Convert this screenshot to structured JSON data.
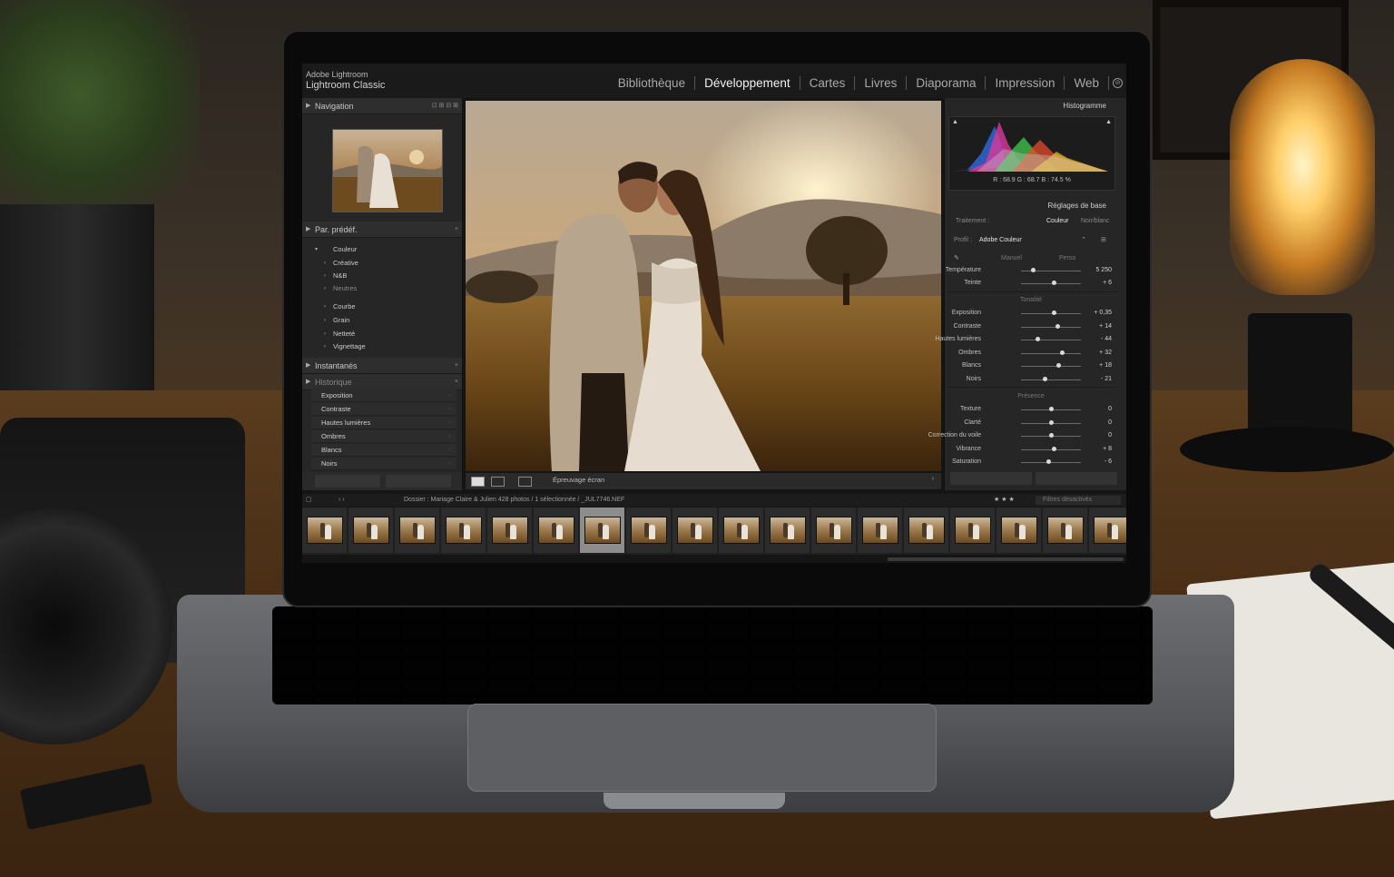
{
  "app": {
    "brand_top": "Adobe Lightroom",
    "brand_name": "Lightroom Classic"
  },
  "modules": [
    {
      "label": "Bibliothèque",
      "active": false
    },
    {
      "label": "Développement",
      "active": true
    },
    {
      "label": "Cartes",
      "active": false
    },
    {
      "label": "Livres",
      "active": false
    },
    {
      "label": "Diaporama",
      "active": false
    },
    {
      "label": "Impression",
      "active": false
    },
    {
      "label": "Web",
      "active": false
    }
  ],
  "left_panel": {
    "navigation_title": "Navigation",
    "presets_title": "Par. prédéf.",
    "presets": [
      "Couleur",
      "Créative",
      "N&B",
      "Neutres",
      "Courbe",
      "Grain",
      "Netteté",
      "Vignettage"
    ],
    "snapshots_title": "Instantanés",
    "history_title": "Historique",
    "history": [
      "Exposition",
      "Contraste",
      "Hautes lumières",
      "Ombres",
      "Blancs",
      "Noirs"
    ]
  },
  "toolbar": {
    "soft_proof_label": "Épreuvage écran"
  },
  "right_panel": {
    "histogram_title": "Histogramme",
    "rgb_readout": "R : 68.9   G : 68.7   B : 74.5  %",
    "basic_title": "Réglages de base",
    "treatment_label": "Traitement :",
    "treatment_color": "Couleur",
    "treatment_bw": "Noir/blanc",
    "profile_label": "Profil :",
    "profile_value": "Adobe Couleur",
    "wb_section": "Manuel",
    "wb_mode": "Perso",
    "tone_section": "Tonalité",
    "presence_section": "Présence",
    "sliders_wb": [
      {
        "label": "Température",
        "value": "5 250",
        "pos": 0.2
      },
      {
        "label": "Teinte",
        "value": "+ 6",
        "pos": 0.55
      }
    ],
    "sliders_tone": [
      {
        "label": "Exposition",
        "value": "+ 0,35",
        "pos": 0.55
      },
      {
        "label": "Contraste",
        "value": "+ 14",
        "pos": 0.6
      },
      {
        "label": "Hautes lumières",
        "value": "- 44",
        "pos": 0.28
      },
      {
        "label": "Ombres",
        "value": "+ 32",
        "pos": 0.68
      },
      {
        "label": "Blancs",
        "value": "+ 18",
        "pos": 0.62
      },
      {
        "label": "Noirs",
        "value": "- 21",
        "pos": 0.4
      }
    ],
    "sliders_presence": [
      {
        "label": "Texture",
        "value": "0",
        "pos": 0.5
      },
      {
        "label": "Clarté",
        "value": "0",
        "pos": 0.5
      },
      {
        "label": "Correction du voile",
        "value": "0",
        "pos": 0.5
      },
      {
        "label": "Vibrance",
        "value": "+ 8",
        "pos": 0.54
      },
      {
        "label": "Saturation",
        "value": "- 6",
        "pos": 0.46
      }
    ]
  },
  "filmstrip": {
    "bar_text": "Dossier : Mariage Claire & Julien     428 photos / 1 sélectionnée /  _JUL7746.NEF",
    "filter_label": "Filtres désactivés",
    "count": 18,
    "selected_index": 6
  },
  "colors": {
    "bg_dark": "#1a1a1a",
    "panel": "#262626",
    "accent_text": "#f2f2f2"
  }
}
